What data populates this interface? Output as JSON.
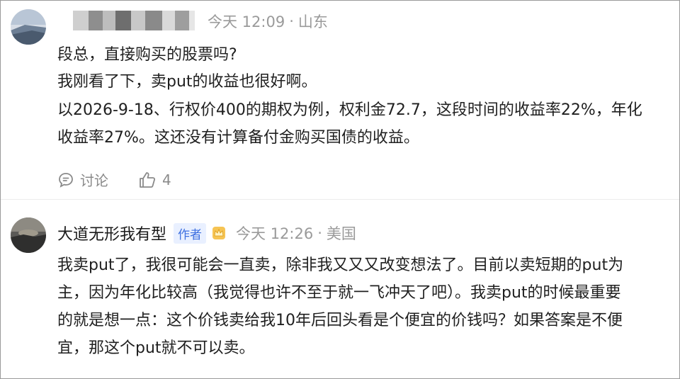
{
  "comments": [
    {
      "username_hidden": true,
      "time": "今天 12:09",
      "location": "山东",
      "lines": [
        "段总，直接购买的股票吗?",
        "我刚看了下，卖put的收益也很好啊。",
        "以2026-9-18、行权价400的期权为例，权利金72.7，这段时间的收益率22%，年化",
        "收益率27%。这还没有计算备付金购买国债的收益。"
      ],
      "discuss_label": "讨论",
      "like_count": "4",
      "icons": {
        "discuss": "comment-icon",
        "like": "thumbs-up-icon"
      }
    },
    {
      "username": "大道无形我有型",
      "badge": "作者",
      "time": "今天 12:26",
      "location": "美国",
      "lines": [
        "我卖put了，我很可能会一直卖，除非我又又又改变想法了。目前以卖短期的put为",
        "主，因为年化比较高（我觉得也许不至于就一飞冲天了吧）。我卖put的时候最重要",
        "的就是想一点：这个价钱卖给我10年后回头看是个便宜的价钱吗？如果答案是不便",
        "宜，那这个put就不可以卖。"
      ],
      "icons": {
        "badge_icon": "crown-icon"
      }
    }
  ],
  "colors": {
    "meta": "#9a9a9a",
    "badge_bg": "#e9f0ff",
    "badge_fg": "#3d6fe0",
    "text": "#1f1f1f"
  }
}
